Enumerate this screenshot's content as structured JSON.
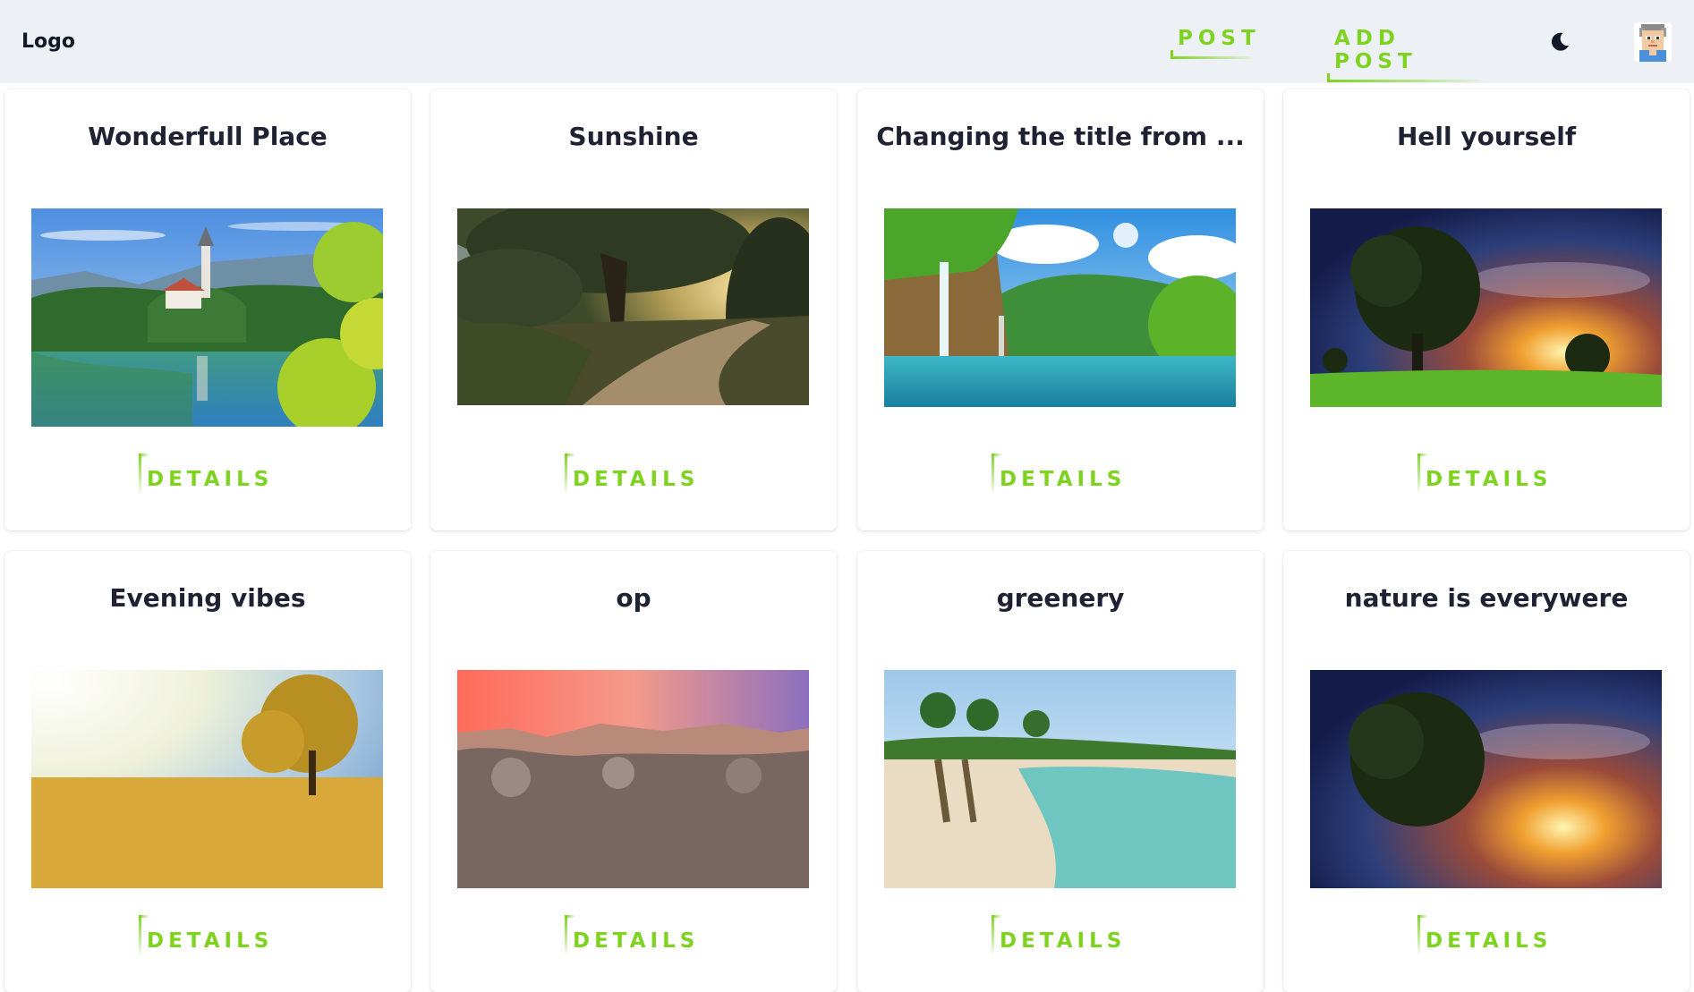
{
  "navbar": {
    "logo": "Logo",
    "links": [
      {
        "label": "POST"
      },
      {
        "label": "ADD POST"
      }
    ],
    "theme_icon": "moon-icon",
    "avatar_icon": "user-avatar",
    "accent_color": "#7ed321",
    "background_color": "#edf1f5"
  },
  "posts": [
    {
      "title": "Wonderfull Place",
      "details_label": "DETAILS",
      "image": "lake-church-island"
    },
    {
      "title": "Sunshine",
      "details_label": "DETAILS",
      "image": "forest-road-sunlight"
    },
    {
      "title": "Changing the title from ...",
      "details_label": "DETAILS",
      "image": "waterfall-lake"
    },
    {
      "title": "Hell yourself",
      "details_label": "DETAILS",
      "image": "tree-sunset-field"
    },
    {
      "title": "Evening vibes",
      "details_label": "DETAILS",
      "image": "golden-tree-field"
    },
    {
      "title": "op",
      "details_label": "DETAILS",
      "image": "rocky-pond-sunset"
    },
    {
      "title": "greenery",
      "details_label": "DETAILS",
      "image": "palm-beach"
    },
    {
      "title": "nature is everywere",
      "details_label": "DETAILS",
      "image": "tree-sunset-field"
    }
  ]
}
